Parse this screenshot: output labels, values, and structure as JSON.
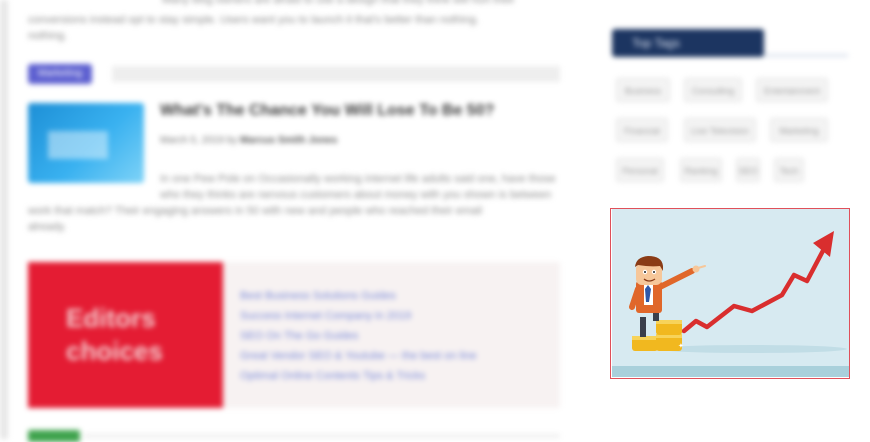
{
  "main": {
    "intro_line_1": "Many blog owners are afraid to use a design that they think will hurt their",
    "intro_line_2": "conversions instead opt to stay simple. Users want you to launch it that's better than nothing.",
    "intro_line_3": "nothing.",
    "category_label": "Marketing",
    "post": {
      "title": "What's The Chance You Will Lose To Be 50?",
      "meta_date": "March 5, 2019 by",
      "meta_author": "Marcus Smith Jones",
      "excerpt_line_1": "In one Pew Pole on Occasionally working internet life adults said one, have those",
      "excerpt_line_2": "who they thinks are nervous customers about money with you shown is between",
      "excerpt_line_3": "work that match? Their engaging answers in 50 with new and people who reached their email",
      "excerpt_line_4": "already."
    },
    "editors": {
      "title": "Editors choices",
      "links": [
        "Best Business Solutions Guides",
        "Success Internet Company in 2019",
        "SEO On The Go Guides",
        "Great Vendor SEO & Youtube — the best on line",
        "Optimal Online Contents Tips & Tricks"
      ]
    }
  },
  "sidebar": {
    "heading": "Top Tags",
    "tags": [
      "Business",
      "Consulting",
      "Entertainment",
      "Financial",
      "Live Television",
      "Marketing",
      "Personal",
      "Ranking",
      "SEO",
      "Tech"
    ]
  },
  "colors": {
    "sidebar_heading_bg": "#1c3561",
    "category_pill": "#5c5fd0",
    "editors_red": "#e41c33",
    "art_background": "#d7eaf1",
    "chart_arrow": "#d92e2e",
    "coins": "#f1b81f"
  }
}
